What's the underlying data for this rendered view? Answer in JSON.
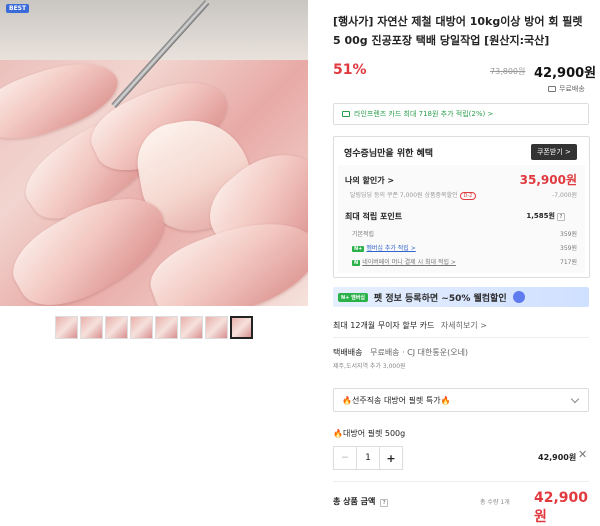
{
  "badge": "BEST",
  "title": "[행사가] 자연산 제철 대방어 10kg이상 방어 회 필렛 5 00g 진공포장 택배 당일작업 [원산지:국산]",
  "discount": "51%",
  "original_price": "73,800원",
  "price": "42,900원",
  "shipping": "무료배송",
  "card_promo": "라인프렌즈 카드 최대 718원 추가 적립(2%) >",
  "benefit": {
    "heading": "영수증님만을 위한 혜택",
    "coupon_button": "쿠폰받기 >",
    "sale_label": "나의 할인가 >",
    "sale_price": "35,900원",
    "sale_sub": "달링딩딩 등의 쿠폰 7,000원 상품중복할인",
    "sale_sub_badge": "D-2",
    "sale_sub_value": "-7,000원",
    "point_label": "최대 적립 포인트",
    "point_value": "1,585원",
    "point_rows": [
      {
        "label": "기본적립",
        "value": "359원",
        "badge": ""
      },
      {
        "label": "멤버십 추가 적립 >",
        "value": "359원",
        "badge": "N+"
      },
      {
        "label": "네이버페이 머니 결제 시 최대 적립 >",
        "value": "717원",
        "badge": "N"
      }
    ]
  },
  "banner": {
    "tag": "N+ 멤버십",
    "text": "펫 정보 등록하면 ~50% 웰컴할인"
  },
  "installment": {
    "label": "최대 12개월 무이자 할부 카드",
    "more": "자세히보기 >"
  },
  "delivery": {
    "label": "택배배송",
    "sub": "무료배송 · CJ 대한통운(오네)",
    "extra": "제주,도서지역 추가 3,000원"
  },
  "select_option": "선주직송 대방어 필렛 특가",
  "option_name": "대방어 필렛 500g",
  "quantity": "1",
  "option_price": "42,900원",
  "total": {
    "label": "총 상품 금액",
    "count": "총 수량 1개",
    "price": "42,900원"
  },
  "thumbnail_count": 8
}
